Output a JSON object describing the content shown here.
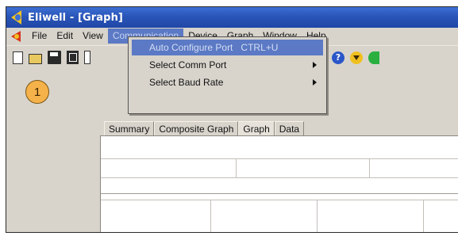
{
  "window": {
    "title": "Eliwell - [Graph]"
  },
  "menubar": {
    "items": [
      "File",
      "Edit",
      "View",
      "Communication",
      "Device",
      "Graph",
      "Window",
      "Help"
    ],
    "active_item": "Communication"
  },
  "toolbar": {
    "icons": [
      "new-file-icon",
      "open-folder-icon",
      "save-disk-icon",
      "copy-icon",
      "print-icon",
      "zoom-icon",
      "zoom-search-icon",
      "help-icon",
      "download-icon",
      "connect-icon"
    ]
  },
  "dropdown": {
    "items": [
      {
        "label": "Auto Configure Port",
        "shortcut": "CTRL+U",
        "highlighted": true,
        "submenu": false
      },
      {
        "label": "Select Comm Port",
        "shortcut": "",
        "highlighted": false,
        "submenu": true
      },
      {
        "label": "Select Baud Rate",
        "shortcut": "",
        "highlighted": false,
        "submenu": true
      }
    ]
  },
  "tabs": {
    "items": [
      "Summary",
      "Composite Graph",
      "Graph",
      "Data"
    ],
    "active": "Graph"
  },
  "callout": {
    "number": "1"
  },
  "colors": {
    "titlebar": "#2a55b8",
    "highlight": "#5b79c4",
    "chrome": "#d8d4cc",
    "callout": "#f5b24a"
  }
}
